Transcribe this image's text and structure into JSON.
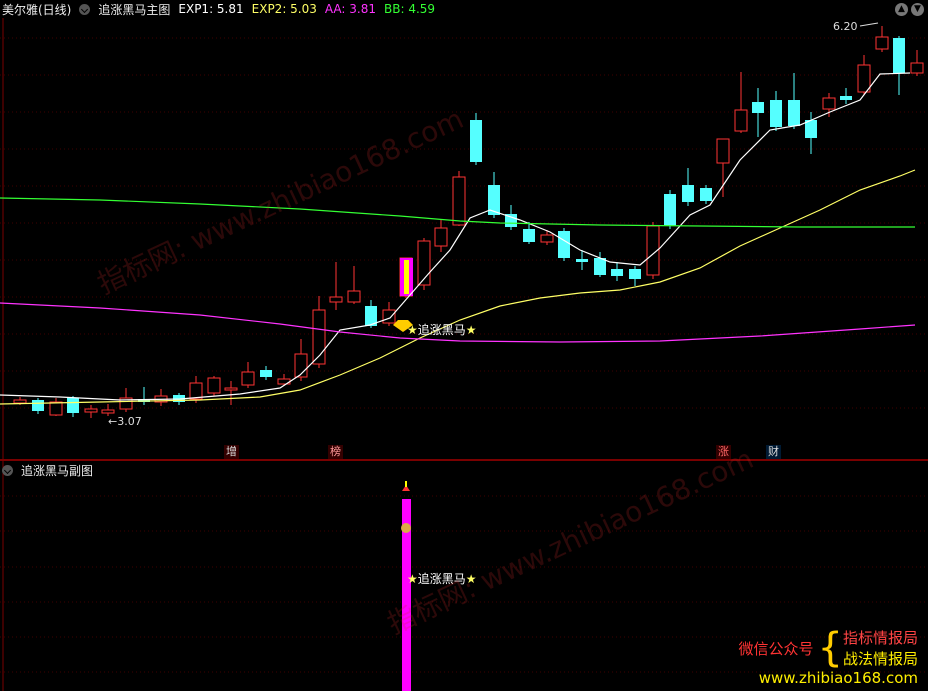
{
  "main": {
    "stock": "美尔雅(日线)",
    "indicator": "追涨黑马主图",
    "params": [
      {
        "label": "EXP1: 5.81",
        "color": "#ffffff"
      },
      {
        "label": "EXP2: 5.03",
        "color": "#ffff66"
      },
      {
        "label": "AA: 3.81",
        "color": "#ff33ff"
      },
      {
        "label": "BB: 4.59",
        "color": "#33ff33"
      }
    ],
    "high_label": "6.20",
    "low_label": "3.07",
    "signal_label": "追涨黑马",
    "tags": [
      {
        "text": "增",
        "color": "#ff6666"
      },
      {
        "text": "榜",
        "color": "#ff6666"
      },
      {
        "text": "涨",
        "color": "#ff6666"
      },
      {
        "text": "财",
        "color": "#66aaff"
      }
    ]
  },
  "sub": {
    "indicator": "追涨黑马副图",
    "signal_label": "追涨黑马"
  },
  "watermarks": [
    "指标网: www.zhibiao168.com",
    "指标网: www.zhibiao168.com"
  ],
  "promo": {
    "left": "微信公众号",
    "right1": "指标情报局",
    "right2": "战法情报局",
    "site": "www.zhibiao168.com"
  },
  "colors": {
    "up": "#ff3333",
    "down": "#55ffff",
    "signal": "#ff00ff"
  }
}
